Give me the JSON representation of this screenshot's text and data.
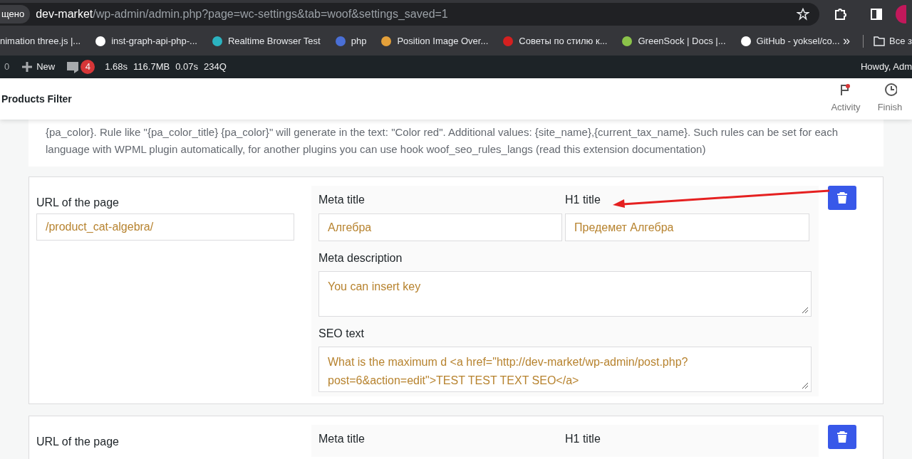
{
  "browser": {
    "security_chip": "щено",
    "url_host": "dev-market",
    "url_path": "/wp-admin/admin.php?page=wc-settings&tab=woof&settings_saved=1",
    "bookmarks": [
      {
        "label": "nimation three.js |..."
      },
      {
        "label": "inst-graph-api-php-..."
      },
      {
        "label": "Realtime Browser Test"
      },
      {
        "label": "php"
      },
      {
        "label": "Position Image Over..."
      },
      {
        "label": "Советы по стилю к..."
      },
      {
        "label": "GreenSock | Docs |..."
      },
      {
        "label": "GitHub - yoksel/co..."
      }
    ],
    "overflow": "»",
    "all_bookmarks": "Все з"
  },
  "admin_bar": {
    "comments": "0",
    "new": "New",
    "badge": "4",
    "stats": [
      "1.68s",
      "116.7MB",
      "0.07s",
      "234Q"
    ],
    "howdy": "Howdy, Adm"
  },
  "header": {
    "title": "Products Filter",
    "actions": [
      {
        "label": "Activity",
        "kind": "flag"
      },
      {
        "label": "Finish",
        "kind": "clock"
      }
    ]
  },
  "description": "{pa_color}. Rule like \"{pa_color_title} {pa_color}\" will generate in the text: \"Color red\". Additional values: {site_name},{current_tax_name}. Such rules can be set for each language with WPML plugin automatically, for another plugins you can use hook woof_seo_rules_langs (read this extension documentation)",
  "rules": [
    {
      "url_label": "URL of the page",
      "url": "/product_cat-algebra/",
      "meta_title_label": "Meta title",
      "meta_title": "Алгебра",
      "h1_label": "H1 title",
      "h1": "Предемет Алгебра",
      "meta_desc_label": "Meta description",
      "meta_desc": "You can insert key",
      "seo_label": "SEO text",
      "seo": "What is the maximum d <a href=\"http://dev-market/wp-admin/post.php?post=6&action=edit\">TEST TEST TEXT SEO</a>"
    },
    {
      "url_label": "URL of the page",
      "meta_title_label": "Meta title",
      "h1_label": "H1 title"
    }
  ]
}
